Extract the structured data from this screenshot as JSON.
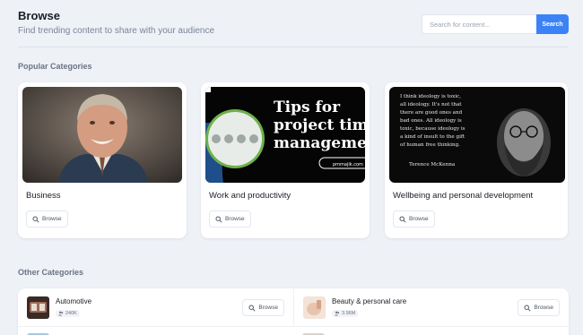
{
  "header": {
    "title": "Browse",
    "subtitle": "Find trending content to share with your audience"
  },
  "search": {
    "placeholder": "Search for content...",
    "button_label": "Search"
  },
  "sections": {
    "popular_title": "Popular Categories",
    "other_title": "Other Categories"
  },
  "popular_categories": [
    {
      "name": "Business",
      "browse_label": "Browse"
    },
    {
      "name": "Work and productivity",
      "browse_label": "Browse",
      "image_text": {
        "headline_1": "Tips for",
        "headline_2": "project time",
        "headline_3": "management",
        "url": "pmmajik.com"
      }
    },
    {
      "name": "Wellbeing and personal development",
      "browse_label": "Browse",
      "image_text": {
        "quote_1": "I think ideology is toxic,",
        "quote_2": "all ideology. It's not that",
        "quote_3": "there are good ones and",
        "quote_4": "bad ones. All ideology is",
        "quote_5": "toxic, because ideology is",
        "quote_6": "a kind of insult to the gift",
        "quote_7": "of human free thinking.",
        "author": "Terence McKenna"
      }
    }
  ],
  "other_categories": [
    {
      "name": "Automotive",
      "count": "240K",
      "browse_label": "Browse"
    },
    {
      "name": "Beauty & personal care",
      "count": "3.96M",
      "browse_label": "Browse"
    }
  ],
  "colors": {
    "accent": "#3b82f6",
    "background": "#eef1f6",
    "card": "#ffffff"
  }
}
